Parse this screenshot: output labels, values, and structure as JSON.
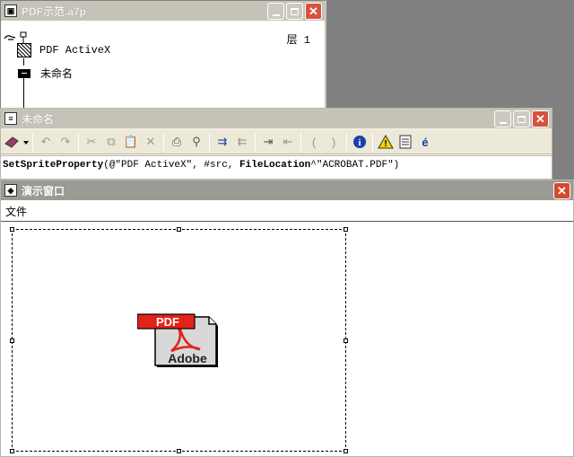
{
  "window_cast": {
    "title": "PDF示范.a7p",
    "layer_label": "层 1",
    "nodes": [
      {
        "label": "PDF ActiveX",
        "icon": "activex-icon"
      },
      {
        "label": "未命名",
        "icon": "script-block-icon"
      }
    ]
  },
  "window_script": {
    "title": "未命名",
    "toolbar_icons": [
      "palette-dropdown-icon",
      "undo-icon",
      "redo-icon",
      "cut-icon",
      "copy-icon",
      "paste-icon",
      "delete-icon",
      "print-icon",
      "find-replace-icon",
      "indent-icon",
      "outdent-icon",
      "comment-icon",
      "uncomment-icon",
      "paren-open-icon",
      "paren-close-icon",
      "info-icon",
      "warning-icon",
      "document-icon",
      "accent-icon"
    ],
    "code": {
      "prefix": "SetSpriteProperty",
      "part2": "(@\"PDF ActiveX\", #src, ",
      "keyword": "FileLocation",
      "part3": "^\"ACROBAT.PDF\")"
    }
  },
  "window_preview": {
    "title": "演示窗口",
    "menu": [
      "文件"
    ],
    "pdf_icon": {
      "badge": "PDF",
      "brand": "Adobe"
    }
  },
  "colors": {
    "close": "#d24a2f",
    "badge_red": "#e2231a",
    "info_blue": "#1c3fa8",
    "warning_yellow": "#f5d000"
  }
}
